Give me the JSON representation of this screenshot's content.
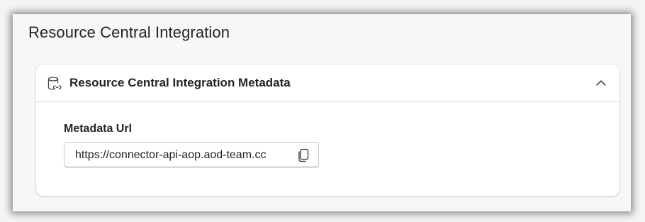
{
  "page": {
    "title": "Resource Central Integration"
  },
  "card": {
    "title": "Resource Central Integration Metadata",
    "header_icon": "database-link-icon",
    "collapse_icon": "chevron-up-icon",
    "expanded": true
  },
  "fields": {
    "metadata_url": {
      "label": "Metadata Url",
      "value": "https://connector-api-aop.aod-team.cc",
      "action_icon": "copy-icon"
    }
  }
}
